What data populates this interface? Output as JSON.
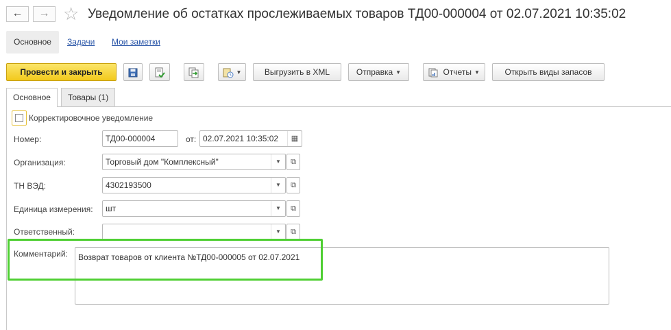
{
  "header": {
    "back_icon": "arrow-left-icon",
    "forward_icon": "arrow-right-icon",
    "favorite_icon": "star-icon",
    "title": "Уведомление об остатках прослеживаемых товаров ТД00-000004 от 02.07.2021 10:35:02"
  },
  "sections": {
    "main": "Основное",
    "tasks": "Задачи",
    "notes": "Мои заметки"
  },
  "toolbar": {
    "post_close": "Провести и закрыть",
    "upload_xml": "Выгрузить в XML",
    "send": "Отправка",
    "reports": "Отчеты",
    "open_stock_types": "Открыть виды запасов"
  },
  "tabs": {
    "main": "Основное",
    "goods": "Товары (1)"
  },
  "form": {
    "corrective_label": "Корректировочное уведомление",
    "corrective_checked": false,
    "number_label": "Номер:",
    "number_value": "ТД00-000004",
    "date_label": "от:",
    "date_value": "02.07.2021 10:35:02",
    "org_label": "Организация:",
    "org_value": "Торговый дом \"Комплексный\"",
    "tnved_label": "ТН ВЭД:",
    "tnved_value": "4302193500",
    "unit_label": "Единица измерения:",
    "unit_value": "шт",
    "responsible_label": "Ответственный:",
    "responsible_value": "",
    "comment_label": "Комментарий:",
    "comment_value": "Возврат товаров от клиента №ТД00-000005 от 02.07.2021"
  },
  "colors": {
    "primary_button": "#f2c91c",
    "highlight": "#4fcf33",
    "link": "#2a56a8"
  }
}
